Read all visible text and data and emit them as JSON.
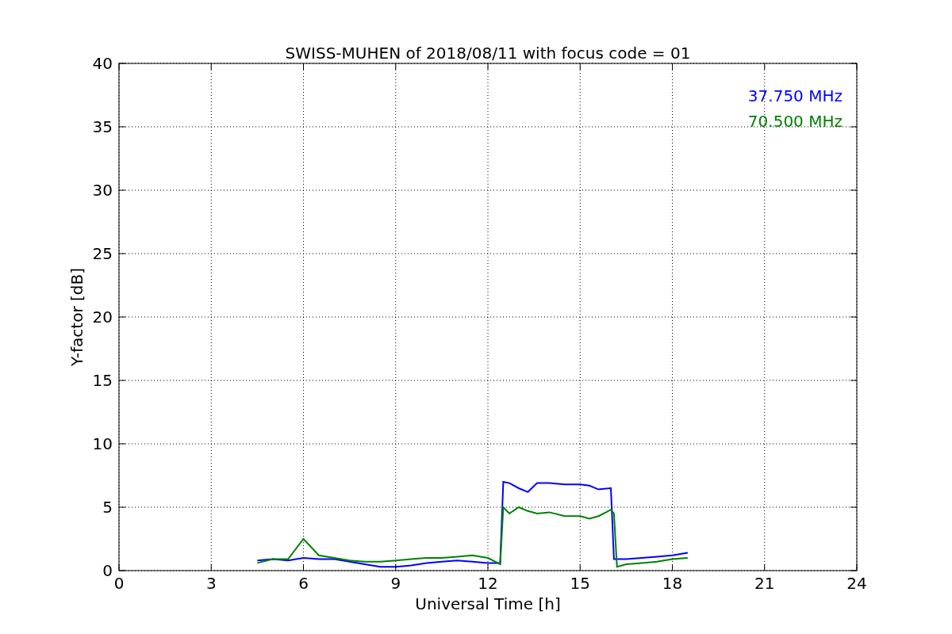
{
  "chart_data": {
    "type": "line",
    "title": "SWISS-MUHEN of 2018/08/11 with focus code = 01",
    "xlabel": "Universal Time [h]",
    "ylabel": "Y-factor [dB]",
    "x": [
      4.5,
      5,
      5.5,
      6,
      6.5,
      7,
      7.5,
      8,
      8.5,
      9,
      9.5,
      10,
      10.5,
      11,
      11.5,
      12,
      12.4,
      12.5,
      12.7,
      13,
      13.3,
      13.6,
      14,
      14.5,
      15,
      15.3,
      15.6,
      16,
      16.1,
      16.2,
      16.5,
      17,
      17.5,
      18,
      18.5
    ],
    "series": [
      {
        "name": "37.750 MHz",
        "color": "#0000ff",
        "values": [
          0.8,
          0.9,
          0.8,
          1.0,
          0.9,
          0.9,
          0.7,
          0.5,
          0.3,
          0.3,
          0.4,
          0.6,
          0.7,
          0.8,
          0.7,
          0.6,
          0.6,
          7.0,
          6.9,
          6.5,
          6.2,
          6.9,
          6.9,
          6.8,
          6.8,
          6.7,
          6.4,
          6.5,
          0.9,
          0.9,
          0.9,
          1.0,
          1.1,
          1.2,
          1.4
        ]
      },
      {
        "name": "70.500 MHz",
        "color": "#008000",
        "values": [
          0.6,
          0.9,
          0.9,
          2.5,
          1.2,
          1.0,
          0.8,
          0.7,
          0.7,
          0.8,
          0.9,
          1.0,
          1.0,
          1.1,
          1.2,
          1.0,
          0.5,
          5.0,
          4.5,
          5.0,
          4.7,
          4.5,
          4.6,
          4.3,
          4.3,
          4.1,
          4.3,
          4.8,
          4.5,
          0.3,
          0.5,
          0.6,
          0.7,
          0.9,
          1.0
        ]
      }
    ],
    "xlim": [
      0,
      24
    ],
    "ylim": [
      0,
      40
    ],
    "xticks": [
      0,
      3,
      6,
      9,
      12,
      15,
      18,
      21,
      24
    ],
    "yticks": [
      0,
      5,
      10,
      15,
      20,
      25,
      30,
      35,
      40
    ],
    "grid": true
  }
}
